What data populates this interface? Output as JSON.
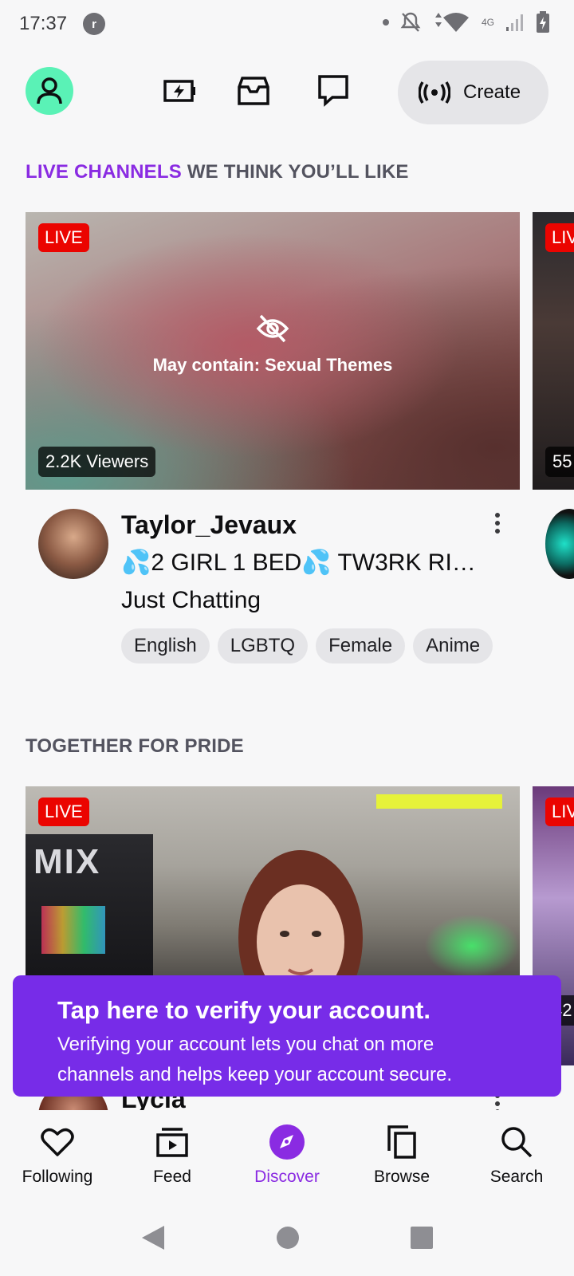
{
  "status_bar": {
    "time": "17:37",
    "app_icon_letter": "r",
    "network": "4G"
  },
  "top_bar": {
    "create_label": "Create"
  },
  "section1": {
    "title_accent": "LIVE CHANNELS",
    "title_rest": " WE THINK YOU’LL LIKE"
  },
  "card1": {
    "live_label": "LIVE",
    "warning": "May contain: Sexual Themes",
    "viewers": "2.2K Viewers",
    "channel_name": "Taylor_Jevaux",
    "stream_title": "💦2 GIRL 1 BED💦 TW3RK RI…",
    "category": "Just Chatting",
    "tags": [
      "English",
      "LGBTQ",
      "Female",
      "Anime"
    ]
  },
  "card1_peek": {
    "live_label": "LIV",
    "viewers": "55"
  },
  "section2": {
    "title": "TOGETHER FOR PRIDE"
  },
  "card2": {
    "live_label": "LIVE",
    "channel_name_partial": "Lycia",
    "overlay_text": "MIX"
  },
  "card2_peek": {
    "live_label": "LIV",
    "viewers": "42"
  },
  "verify_banner": {
    "heading": "Tap here to verify your account.",
    "body_line1": "Verifying your account lets you chat on more",
    "body_line2": "channels and helps keep your account secure."
  },
  "bottom_nav": {
    "items": [
      {
        "label": "Following",
        "icon": "heart-icon"
      },
      {
        "label": "Feed",
        "icon": "feed-icon"
      },
      {
        "label": "Discover",
        "icon": "compass-icon"
      },
      {
        "label": "Browse",
        "icon": "browse-icon"
      },
      {
        "label": "Search",
        "icon": "search-icon"
      }
    ],
    "active": "Discover"
  },
  "colors": {
    "accent": "#8a2be2",
    "banner": "#772ce8",
    "live": "#eb0400",
    "avatar": "#5af2b6"
  }
}
